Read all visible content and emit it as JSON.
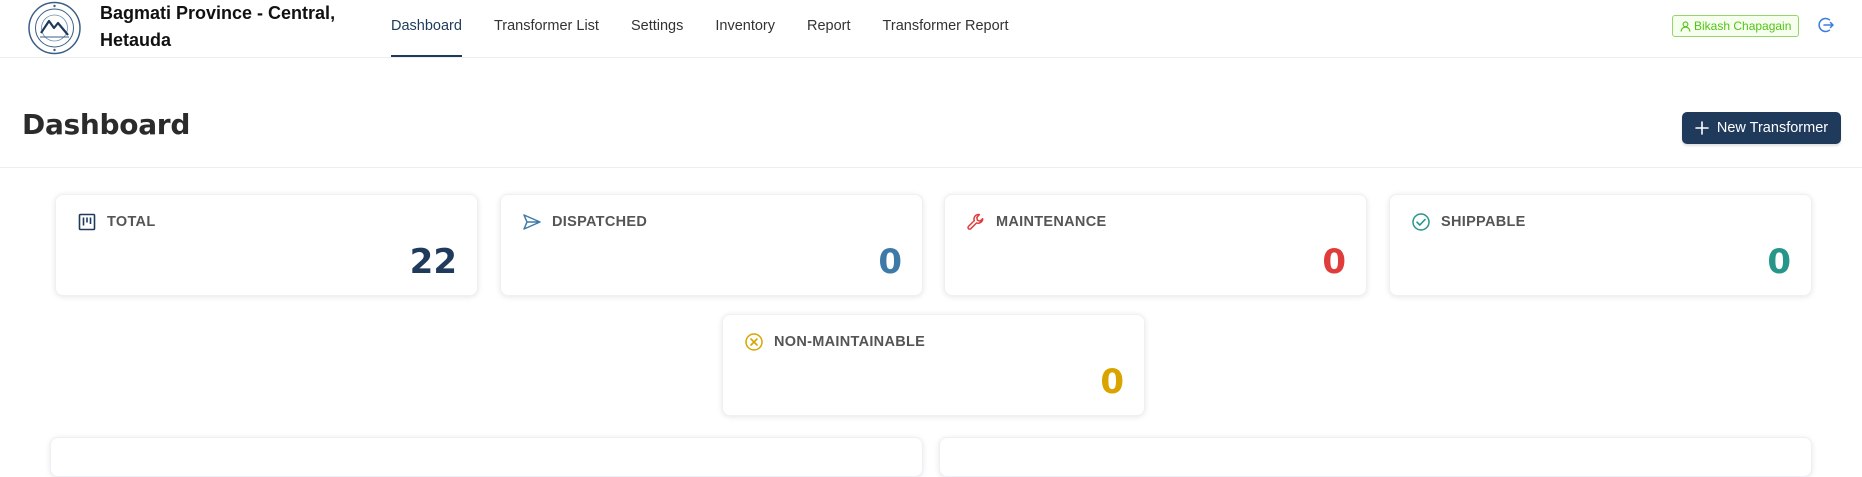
{
  "header": {
    "org_title": "Bagmati Province - Central, Hetauda",
    "nav": [
      {
        "label": "Dashboard",
        "active": true
      },
      {
        "label": "Transformer List",
        "active": false
      },
      {
        "label": "Settings",
        "active": false
      },
      {
        "label": "Inventory",
        "active": false
      },
      {
        "label": "Report",
        "active": false
      },
      {
        "label": "Transformer Report",
        "active": false
      }
    ],
    "user_name": "Bikash Chapagain",
    "user_icon": "user-icon",
    "logout_icon": "logout-icon"
  },
  "page": {
    "title": "Dashboard",
    "new_button_label": "New Transformer",
    "new_button_icon": "plus-icon"
  },
  "stats": [
    {
      "label": "TOTAL",
      "value": "22",
      "icon": "board-icon",
      "color": "#1f3a5a"
    },
    {
      "label": "DISPATCHED",
      "value": "0",
      "icon": "send-icon",
      "color": "#3e7aa8"
    },
    {
      "label": "MAINTENANCE",
      "value": "0",
      "icon": "wrench-icon",
      "color": "#e03c3c"
    },
    {
      "label": "SHIPPABLE",
      "value": "0",
      "icon": "check-circle-icon",
      "color": "#26968a"
    },
    {
      "label": "NON-MAINTAINABLE",
      "value": "0",
      "icon": "close-circle-icon",
      "color": "#d9a400"
    }
  ],
  "colors": {
    "primary": "#1f3a5a",
    "user_badge": "#52c41a"
  }
}
